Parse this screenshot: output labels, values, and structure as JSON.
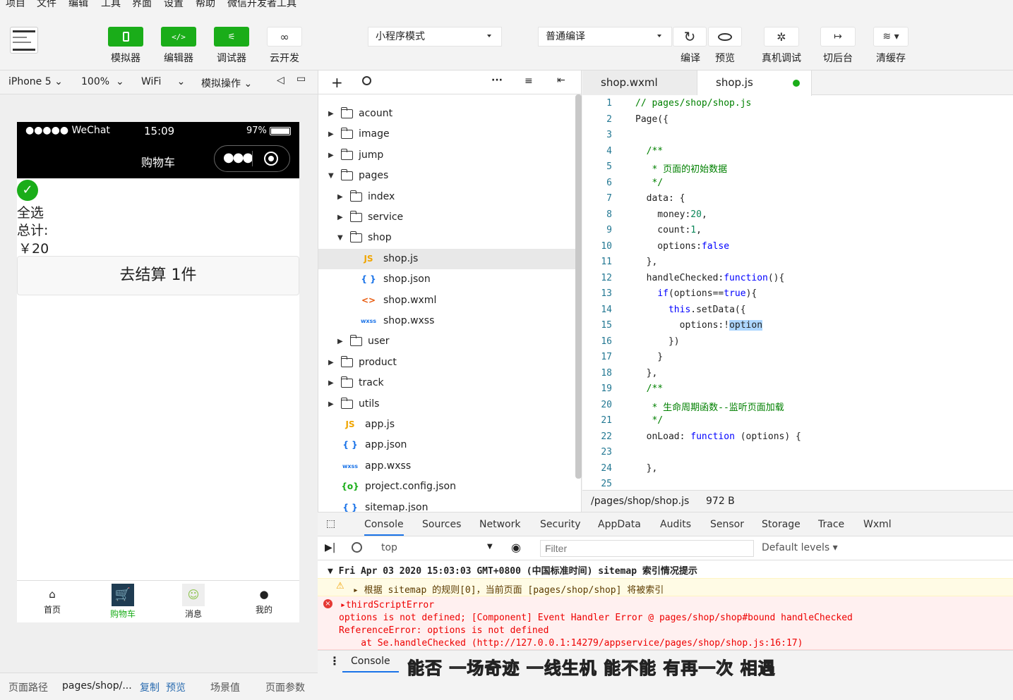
{
  "menu": [
    "项目",
    "文件",
    "编辑",
    "工具",
    "界面",
    "设置",
    "帮助",
    "微信开发者工具"
  ],
  "toolbar": {
    "buttons": [
      {
        "label": "模拟器",
        "icon": "phone-icon"
      },
      {
        "label": "编辑器",
        "icon": "code-icon"
      },
      {
        "label": "调试器",
        "icon": "debug-icon"
      },
      {
        "label": "云开发",
        "icon": "cloud-icon"
      }
    ],
    "mode": "小程序模式",
    "compile": "普通编译",
    "right": [
      {
        "label": "编译",
        "icon": "refresh-icon"
      },
      {
        "label": "预览",
        "icon": "eye-icon"
      },
      {
        "label": "真机调试",
        "icon": "bug-icon"
      },
      {
        "label": "切后台",
        "icon": "switch-icon"
      },
      {
        "label": "清缓存",
        "icon": "layers-icon"
      }
    ]
  },
  "sim": {
    "device": "iPhone 5",
    "zoom": "100%",
    "network": "WiFi",
    "ops": "模拟操作"
  },
  "phone": {
    "carrier": "●●●●● WeChat",
    "time": "15:09",
    "battery": "97%",
    "title": "购物车",
    "select_all": "全选",
    "total_label": "总计:",
    "total": "￥20",
    "checkout": "去结算 1件",
    "tabs": [
      {
        "label": "首页"
      },
      {
        "label": "购物车"
      },
      {
        "label": "消息"
      },
      {
        "label": "我的"
      }
    ]
  },
  "files": [
    {
      "name": "acount",
      "type": "folder",
      "depth": 0,
      "open": false
    },
    {
      "name": "image",
      "type": "folder",
      "depth": 0,
      "open": false
    },
    {
      "name": "jump",
      "type": "folder",
      "depth": 0,
      "open": false
    },
    {
      "name": "pages",
      "type": "folder",
      "depth": 0,
      "open": true
    },
    {
      "name": "index",
      "type": "folder",
      "depth": 1,
      "open": false
    },
    {
      "name": "service",
      "type": "folder",
      "depth": 1,
      "open": false
    },
    {
      "name": "shop",
      "type": "folder",
      "depth": 1,
      "open": true
    },
    {
      "name": "shop.js",
      "type": "js",
      "depth": 2
    },
    {
      "name": "shop.json",
      "type": "json",
      "depth": 2
    },
    {
      "name": "shop.wxml",
      "type": "wxml",
      "depth": 2
    },
    {
      "name": "shop.wxss",
      "type": "wxss",
      "depth": 2
    },
    {
      "name": "user",
      "type": "folder",
      "depth": 1,
      "open": false
    },
    {
      "name": "product",
      "type": "folder",
      "depth": 0,
      "open": false
    },
    {
      "name": "track",
      "type": "folder",
      "depth": 0,
      "open": false
    },
    {
      "name": "utils",
      "type": "folder",
      "depth": 0,
      "open": false
    },
    {
      "name": "app.js",
      "type": "js",
      "depth": 0
    },
    {
      "name": "app.json",
      "type": "json",
      "depth": 0
    },
    {
      "name": "app.wxss",
      "type": "wxss",
      "depth": 0
    },
    {
      "name": "project.config.json",
      "type": "config",
      "depth": 0
    },
    {
      "name": "sitemap.json",
      "type": "json",
      "depth": 0
    }
  ],
  "editor": {
    "tabs": [
      "shop.wxml",
      "shop.js"
    ],
    "path": "/pages/shop/shop.js",
    "size": "972 B",
    "lines": [
      "// pages/shop/shop.js",
      "Page({",
      "",
      "  /**",
      "   * 页面的初始数据",
      "   */",
      "  data: {",
      "    money:20,",
      "    count:1,",
      "    options:false",
      "  },",
      "  handleChecked:function(){",
      "    if(options==true){",
      "      this.setData({",
      "        options:!option",
      "      })",
      "    }",
      "  },",
      "  /**",
      "   * 生命周期函数--监听页面加载",
      "   */",
      "  onLoad: function (options) {",
      "",
      "  },",
      ""
    ]
  },
  "devtools": {
    "tabs": [
      "Console",
      "Sources",
      "Network",
      "Security",
      "AppData",
      "Audits",
      "Sensor",
      "Storage",
      "Trace",
      "Wxml"
    ],
    "context": "top",
    "filter_placeholder": "Filter",
    "levels": "Default levels",
    "log_header": "Fri Apr 03 2020 15:03:03 GMT+0800 (中国标准时间) sitemap 索引情况提示",
    "warning": "根据 sitemap 的规则[0]，当前页面 [pages/shop/shop] 将被索引",
    "error_title": "thirdScriptError",
    "error_l1": "options is not defined; [Component] Event Handler Error @ pages/shop/shop#bound handleChecked",
    "error_l2": "ReferenceError: options is not defined",
    "error_l3": "    at Se.handleChecked (http://127.0.0.1:14279/appservice/pages/shop/shop.js:16:17)",
    "drawer_tab": "Console",
    "subtitle": "能否 一场奇迹 一线生机 能不能 有再一次 相遇"
  },
  "status": {
    "path_label": "页面路径",
    "path": "pages/shop/...",
    "copy": "复制",
    "preview": "预览",
    "scene": "场景值",
    "params": "页面参数"
  }
}
